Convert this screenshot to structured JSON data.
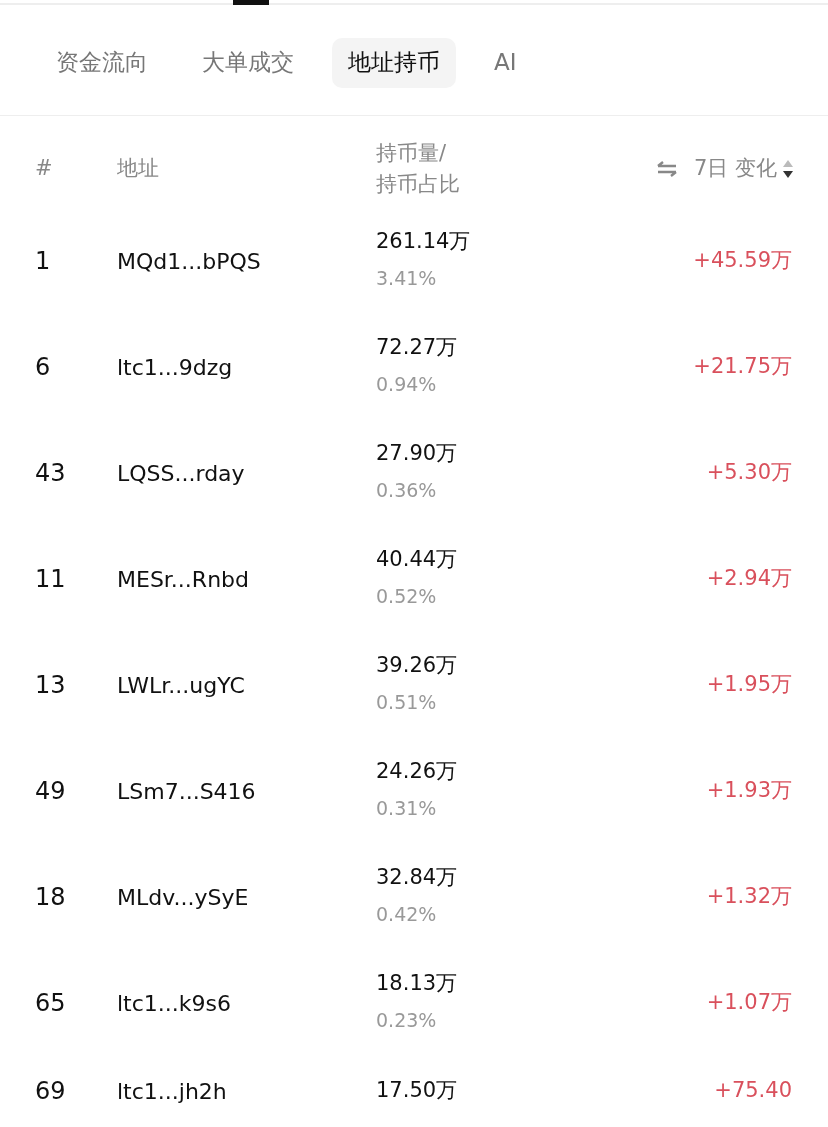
{
  "tabs": [
    {
      "label": "资金流向",
      "selected": false
    },
    {
      "label": "大单成交",
      "selected": false
    },
    {
      "label": "地址持币",
      "selected": true
    },
    {
      "label": "AI",
      "selected": false
    }
  ],
  "table": {
    "columns": [
      {
        "label": "#"
      },
      {
        "label": "地址"
      },
      {
        "label": "持币量/\n持币占比"
      },
      {
        "label": "7日 变化",
        "sort_descending": true
      }
    ],
    "rows": [
      {
        "rank": "1",
        "address": "MQd1...bPQS",
        "amount": "261.14万",
        "share": "3.41%",
        "change": "+45.59万"
      },
      {
        "rank": "6",
        "address": "ltc1...9dzg",
        "amount": "72.27万",
        "share": "0.94%",
        "change": "+21.75万"
      },
      {
        "rank": "43",
        "address": "LQSS...rday",
        "amount": "27.90万",
        "share": "0.36%",
        "change": "+5.30万"
      },
      {
        "rank": "11",
        "address": "MESr...Rnbd",
        "amount": "40.44万",
        "share": "0.52%",
        "change": "+2.94万"
      },
      {
        "rank": "13",
        "address": "LWLr...ugYC",
        "amount": "39.26万",
        "share": "0.51%",
        "change": "+1.95万"
      },
      {
        "rank": "49",
        "address": "LSm7...S416",
        "amount": "24.26万",
        "share": "0.31%",
        "change": "+1.93万"
      },
      {
        "rank": "18",
        "address": "MLdv...ySyE",
        "amount": "32.84万",
        "share": "0.42%",
        "change": "+1.32万"
      },
      {
        "rank": "65",
        "address": "ltc1...k9s6",
        "amount": "18.13万",
        "share": "0.23%",
        "change": "+1.07万"
      },
      {
        "rank": "69",
        "address": "ltc1...jh2h",
        "amount": "17.50万",
        "change": "+75.40"
      }
    ]
  }
}
